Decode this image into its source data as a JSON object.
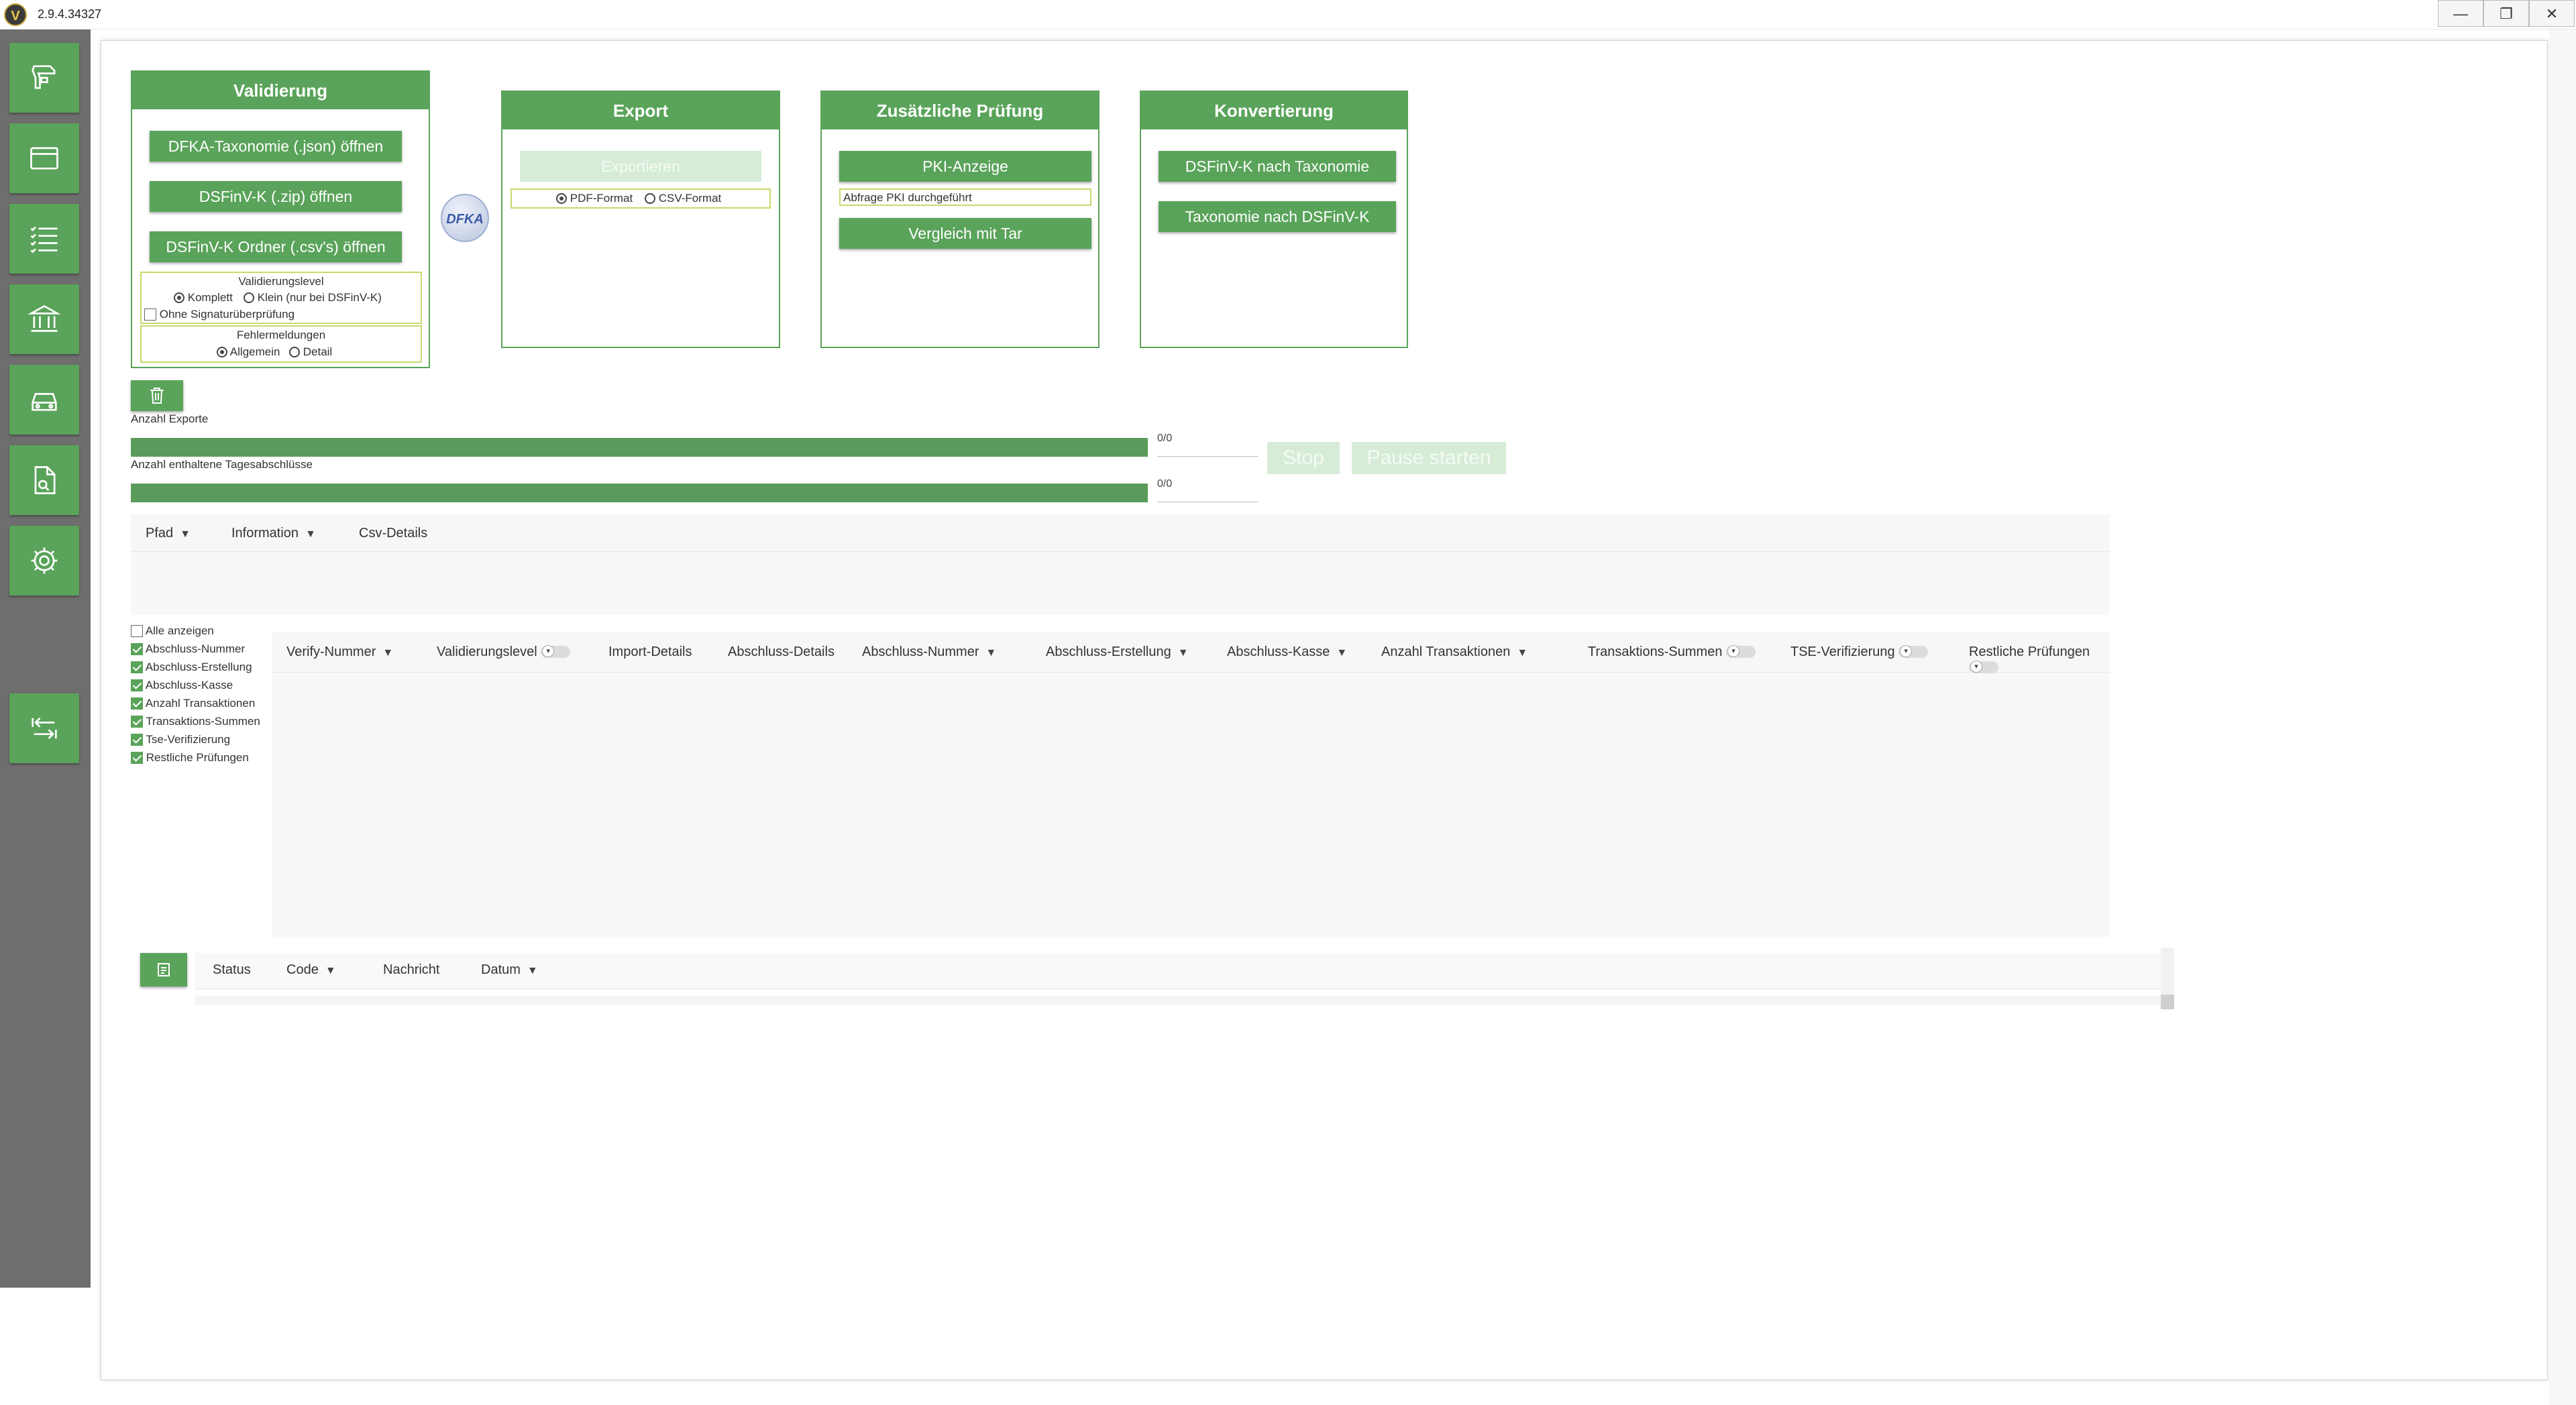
{
  "window": {
    "version": "2.9.4.34327",
    "controls": {
      "minimize": "—",
      "restore": "❐",
      "close": "✕"
    }
  },
  "sidebar": {
    "items": [
      {
        "icon": "scanner-icon"
      },
      {
        "icon": "card-icon"
      },
      {
        "icon": "list-icon"
      },
      {
        "icon": "bank-icon"
      },
      {
        "icon": "car-icon"
      },
      {
        "icon": "document-search-icon"
      },
      {
        "icon": "gear-icon"
      },
      {
        "icon": "collapse-arrows-icon"
      }
    ]
  },
  "validierung": {
    "title": "Validierung",
    "btn_taxonomie": "DFKA-Taxonomie (.json) öffnen",
    "btn_zip": "DSFinV-K (.zip) öffnen",
    "btn_ordner": "DSFinV-K Ordner (.csv's) öffnen",
    "level_label": "Validierungslevel",
    "level_komplett": "Komplett",
    "level_klein": "Klein (nur bei DSFinV-K)",
    "ohne_signatur": "Ohne Signaturüberprüfung",
    "fehler_label": "Fehlermeldungen",
    "fehler_allgemein": "Allgemein",
    "fehler_detail": "Detail"
  },
  "logo": {
    "text": "DFKA"
  },
  "export": {
    "title": "Export",
    "btn_exportieren": "Exportieren",
    "pdf": "PDF-Format",
    "csv": "CSV-Format"
  },
  "pruefung": {
    "title": "Zusätzliche Prüfung",
    "btn_pki": "PKI-Anzeige",
    "pki_status": "Abfrage PKI durchgeführt",
    "btn_vergleich": "Vergleich mit Tar"
  },
  "konvertierung": {
    "title": "Konvertierung",
    "btn_nach_tax": "DSFinV-K nach Taxonomie",
    "btn_nach_dsfinvk": "Taxonomie nach DSFinV-K"
  },
  "progress": {
    "exports_label": "Anzahl Exporte",
    "exports_count": "0/0",
    "exports_fill": 1.0,
    "tages_label": "Anzahl enthaltene Tagesabschlüsse",
    "tages_count": "0/0",
    "tages_fill": 1.0,
    "stop": "Stop",
    "pause": "Pause starten"
  },
  "files_table": {
    "columns": [
      "Pfad",
      "Information",
      "Csv-Details"
    ]
  },
  "column_toggles": [
    {
      "label": "Alle anzeigen",
      "checked": false
    },
    {
      "label": "Abschluss-Nummer",
      "checked": true
    },
    {
      "label": "Abschluss-Erstellung",
      "checked": true
    },
    {
      "label": "Abschluss-Kasse",
      "checked": true
    },
    {
      "label": "Anzahl Transaktionen",
      "checked": true
    },
    {
      "label": "Transaktions-Summen",
      "checked": true
    },
    {
      "label": "Tse-Verifizierung",
      "checked": true
    },
    {
      "label": "Restliche Prüfungen",
      "checked": true
    }
  ],
  "results_table": {
    "columns": [
      "Verify-Nummer",
      "Validierungslevel",
      "Import-Details",
      "Abschluss-Details",
      "Abschluss-Nummer",
      "Abschluss-Erstellung",
      "Abschluss-Kasse",
      "Anzahl Transaktionen",
      "Transaktions-Summen",
      "TSE-Verifizierung",
      "Restliche Prüfungen"
    ]
  },
  "messages_table": {
    "columns": [
      "Status",
      "Code",
      "Nachricht",
      "Datum"
    ]
  },
  "colors": {
    "accent": "#5aa35a",
    "sidebar": "#6e6e6e"
  }
}
